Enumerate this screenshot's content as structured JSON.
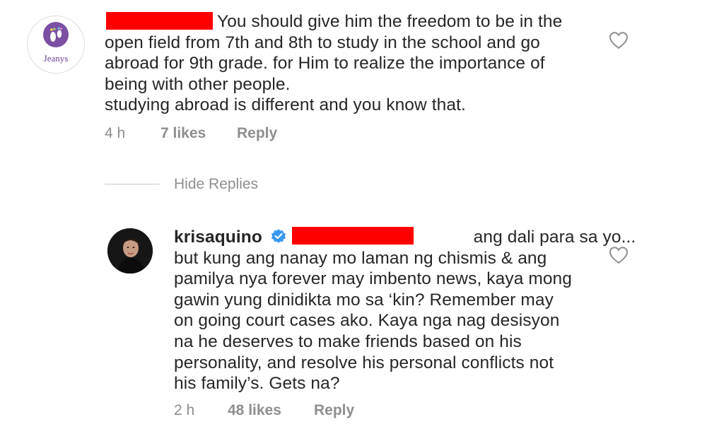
{
  "comment1": {
    "avatar_brand": "Jeanys",
    "lines": [
      "You should give him the freedom to be in the",
      "open field from 7th and 8th to study in the school and go",
      "abroad for 9th grade. for Him to realize the importance of",
      "being with other people.",
      "studying abroad is different and you know that."
    ],
    "time": "4 h",
    "likes": "7 likes",
    "reply": "Reply"
  },
  "hide_replies": "Hide Replies",
  "comment2": {
    "username": "krisaquino",
    "first_line_text": "ang dali para sa yo...",
    "lines": [
      "but kung ang nanay mo laman ng chismis & ang",
      "pamilya nya forever may imbento news, kaya mong",
      "gawin yung dinidikta mo sa ‘kin? Remember may",
      "on going court cases ako. Kaya nga nag desisyon",
      "na he deserves to make friends based on his",
      "personality, and resolve his personal conflicts not",
      "his family’s. Gets na?"
    ],
    "time": "2 h",
    "likes": "48 likes",
    "reply": "Reply"
  },
  "colors": {
    "redaction": "#ff0000",
    "verified": "#3897f0",
    "meta_text": "#8e8e8e",
    "body_text": "#262626"
  },
  "icons": [
    "heart-outline-icon",
    "verified-badge-icon"
  ]
}
